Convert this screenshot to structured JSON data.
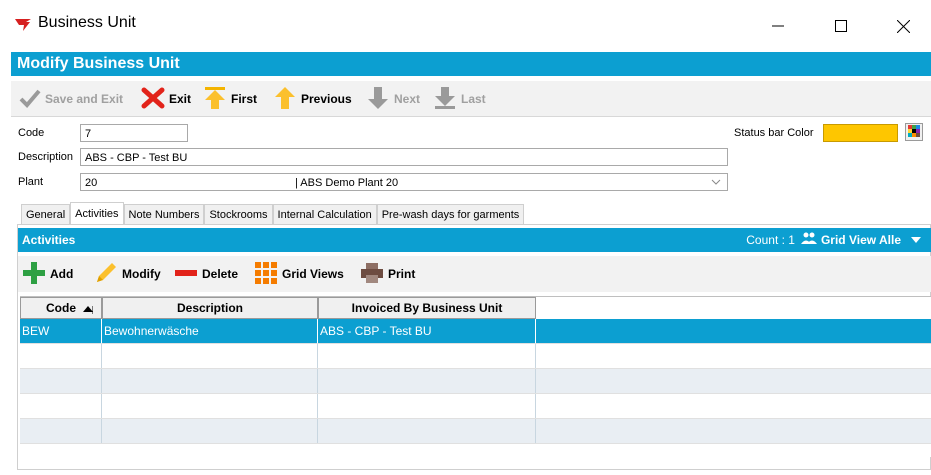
{
  "window": {
    "title": "Business Unit"
  },
  "header": {
    "title": "Modify Business Unit"
  },
  "toolbar": {
    "save_exit": "Save and Exit",
    "exit": "Exit",
    "first": "First",
    "previous": "Previous",
    "next": "Next",
    "last": "Last"
  },
  "form": {
    "code_label": "Code",
    "code_value": "7",
    "description_label": "Description",
    "description_value": "ABS - CBP - Test BU",
    "plant_label": "Plant",
    "plant_code": "20",
    "plant_name": "| ABS Demo Plant 20",
    "status_bar_color_label": "Status bar Color",
    "status_bar_color": "#fec600"
  },
  "tabs": [
    "General",
    "Activities",
    "Note Numbers",
    "Stockrooms",
    "Internal Calculation",
    "Pre-wash days for garments"
  ],
  "activities": {
    "title": "Activities",
    "count_text": "Count : 1",
    "grid_view_label": "Grid View Alle"
  },
  "grid_toolbar": {
    "add": "Add",
    "modify": "Modify",
    "delete": "Delete",
    "grid_views": "Grid Views",
    "print": "Print"
  },
  "grid": {
    "columns": [
      "Code",
      "Description",
      "Invoiced By Business Unit"
    ],
    "rows": [
      [
        "BEW",
        "Bewohnerwäsche",
        "ABS - CBP - Test BU"
      ]
    ]
  },
  "colors": {
    "accent": "#0c9fd1",
    "selected_row": "#0c9fd1"
  }
}
